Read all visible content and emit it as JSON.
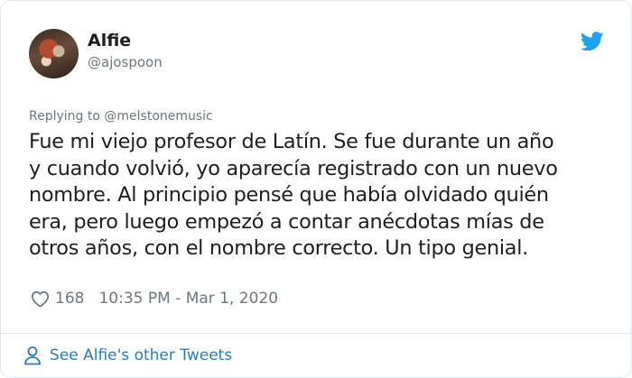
{
  "tweet": {
    "author_name": "Alfie",
    "author_handle": "@ajospoon",
    "replying_to_prefix": "Replying to ",
    "replying_to_handle": "@melstonemusic",
    "text_lines": [
      "Fue mi viejo profesor de Latín. Se fue durante un año",
      "y cuando volvió, yo aparecía registrado con un nuevo",
      "nombre. Al principio pensé que había olvidado quién",
      "era, pero luego empezó a contar anécdotas mías de",
      "otros años, con el nombre correcto. Un tipo genial."
    ],
    "likes": "168",
    "timestamp": "10:35 PM - Mar 1, 2020"
  },
  "footer": {
    "see_more_label": "See Alfie's other Tweets"
  },
  "icons": {
    "brand": "twitter-bird-icon",
    "like": "heart-icon",
    "profile": "person-icon"
  },
  "colors": {
    "brand_blue": "#1da1f2",
    "link_blue": "#2b7bb9",
    "secondary_text": "#697882",
    "primary_text": "#1c2022",
    "border": "#e1e8ed"
  }
}
